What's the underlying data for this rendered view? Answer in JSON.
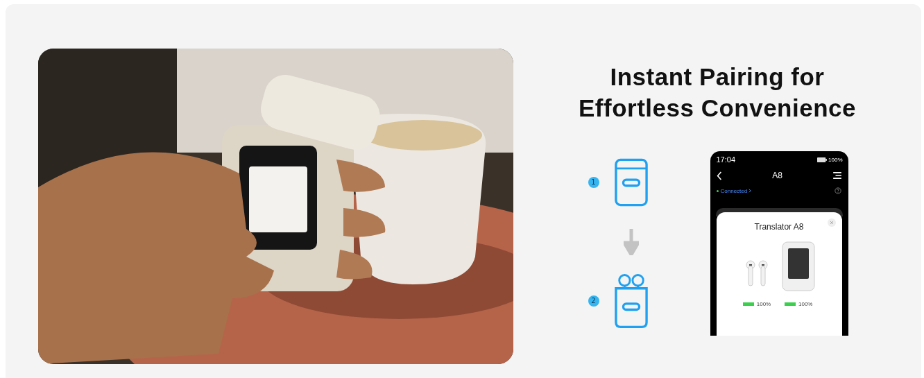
{
  "title_lines": [
    "Instant Pairing for",
    "Effortless Convenience"
  ],
  "steps": [
    {
      "number": "1",
      "kind": "case"
    },
    {
      "number": "2",
      "kind": "case-with-earbuds"
    }
  ],
  "phone": {
    "time": "17:04",
    "battery": "100%",
    "title": "A8",
    "status": "Connected",
    "connected": true,
    "popup": {
      "title": "Translator A8",
      "items": [
        {
          "kind": "earbuds",
          "battery": "100%",
          "level": 1
        },
        {
          "kind": "device",
          "battery": "100%",
          "level": 1
        }
      ]
    }
  }
}
